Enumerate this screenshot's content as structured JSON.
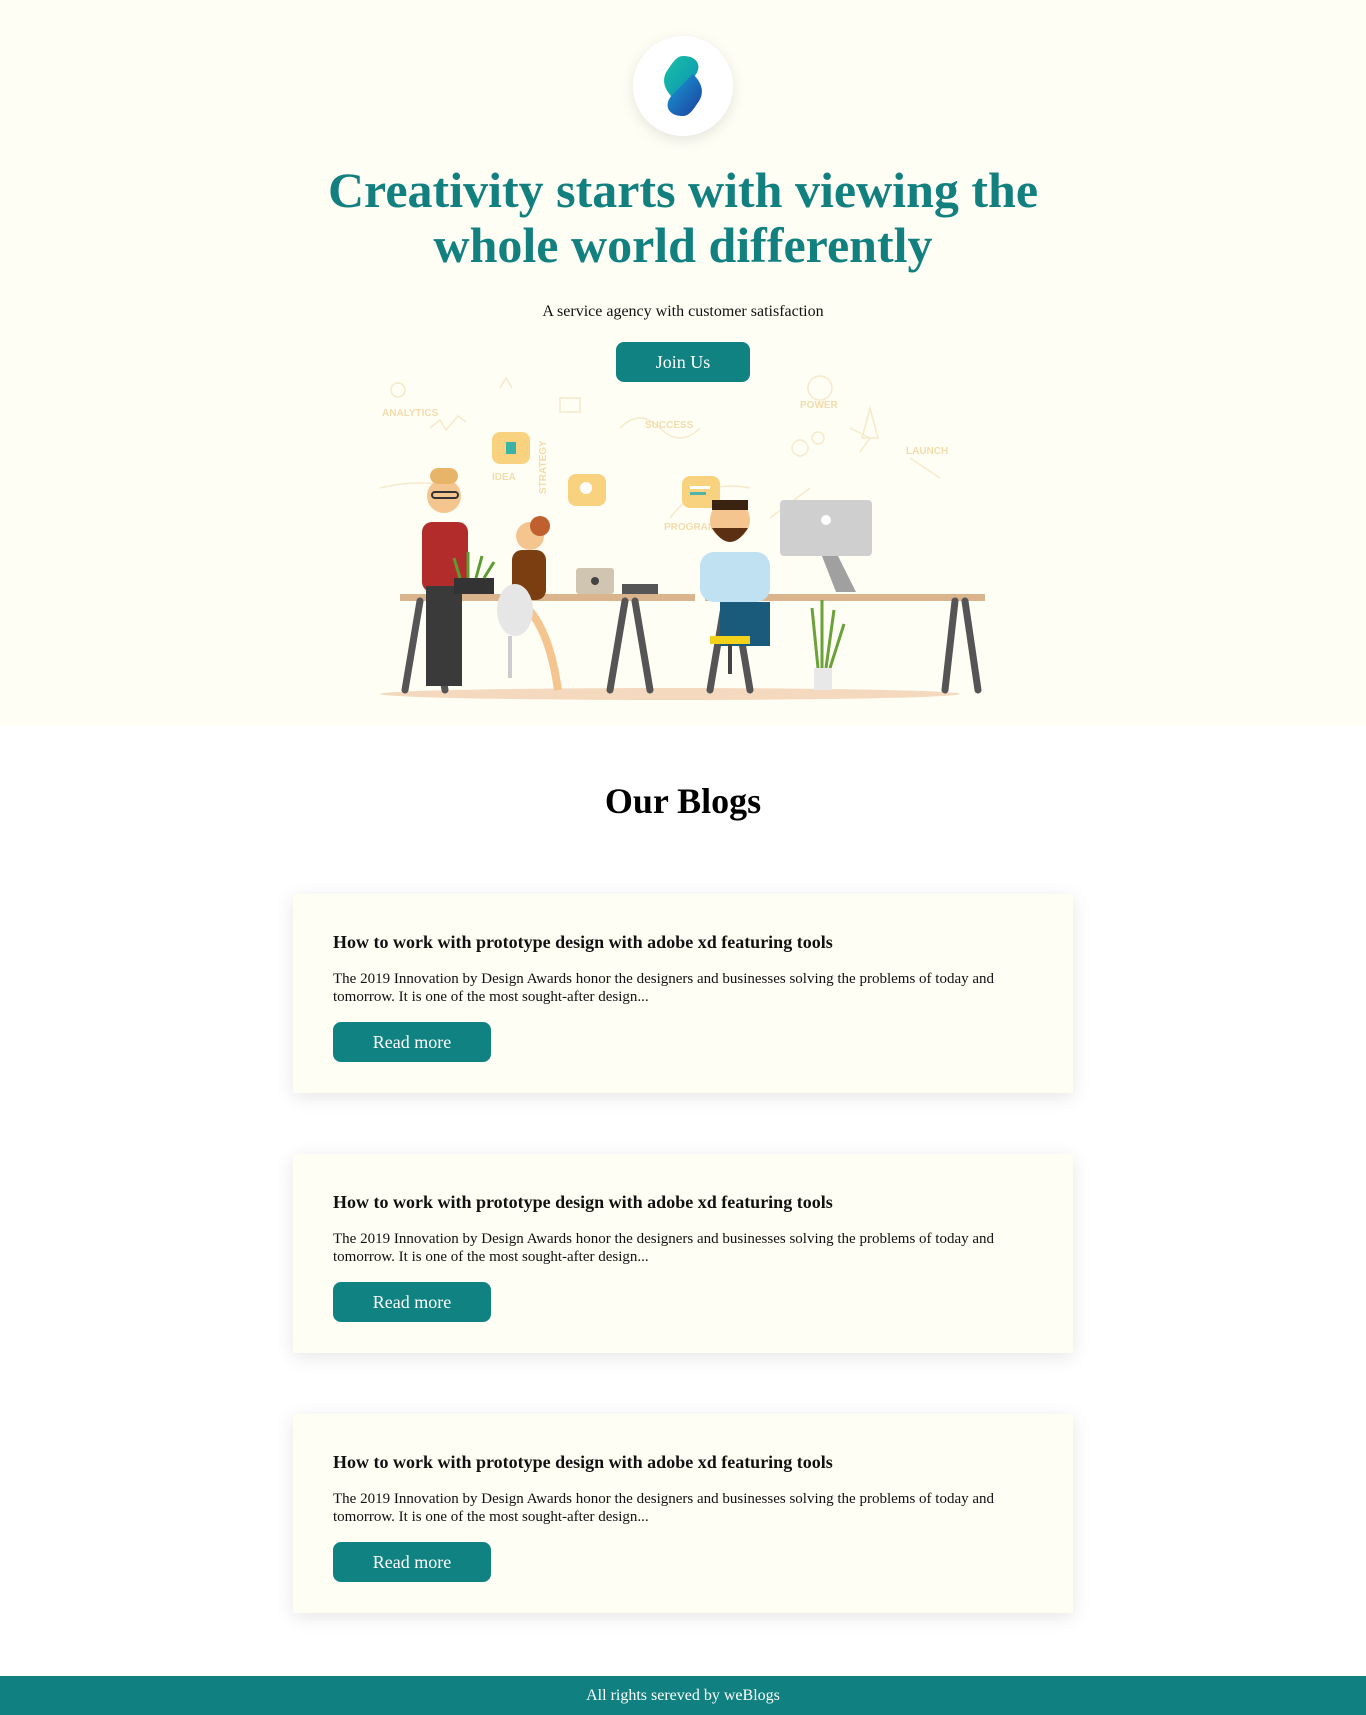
{
  "hero": {
    "title": "Creativity starts with viewing the whole world differently",
    "subtitle": "A service agency with customer satisfaction",
    "join_label": "Join Us",
    "illustration_words": [
      "ANALYTICS",
      "IDEA",
      "STRATEGY",
      "SUCCESS",
      "PROGRAMMING",
      "POWER",
      "LAUNCH"
    ]
  },
  "blogs": {
    "title": "Our Blogs",
    "posts": [
      {
        "title": "How to work with prototype design with adobe xd featuring tools",
        "excerpt": "The 2019 Innovation by Design Awards honor the designers and businesses solving the problems of today and tomorrow. It is one of the most sought-after design...",
        "button": "Read more"
      },
      {
        "title": "How to work with prototype design with adobe xd featuring tools",
        "excerpt": "The 2019 Innovation by Design Awards honor the designers and businesses solving the problems of today and tomorrow. It is one of the most sought-after design...",
        "button": "Read more"
      },
      {
        "title": "How to work with prototype design with adobe xd featuring tools",
        "excerpt": "The 2019 Innovation by Design Awards honor the designers and businesses solving the problems of today and tomorrow. It is one of the most sought-after design...",
        "button": "Read more"
      }
    ]
  },
  "footer": {
    "text": "All rights sereved by weBlogs"
  },
  "colors": {
    "accent": "#118282",
    "heading": "#138080",
    "hero_bg": "#fefef5",
    "card_bg": "#fefef5"
  },
  "icons": {
    "logo": "gradient-s-logo-icon"
  }
}
